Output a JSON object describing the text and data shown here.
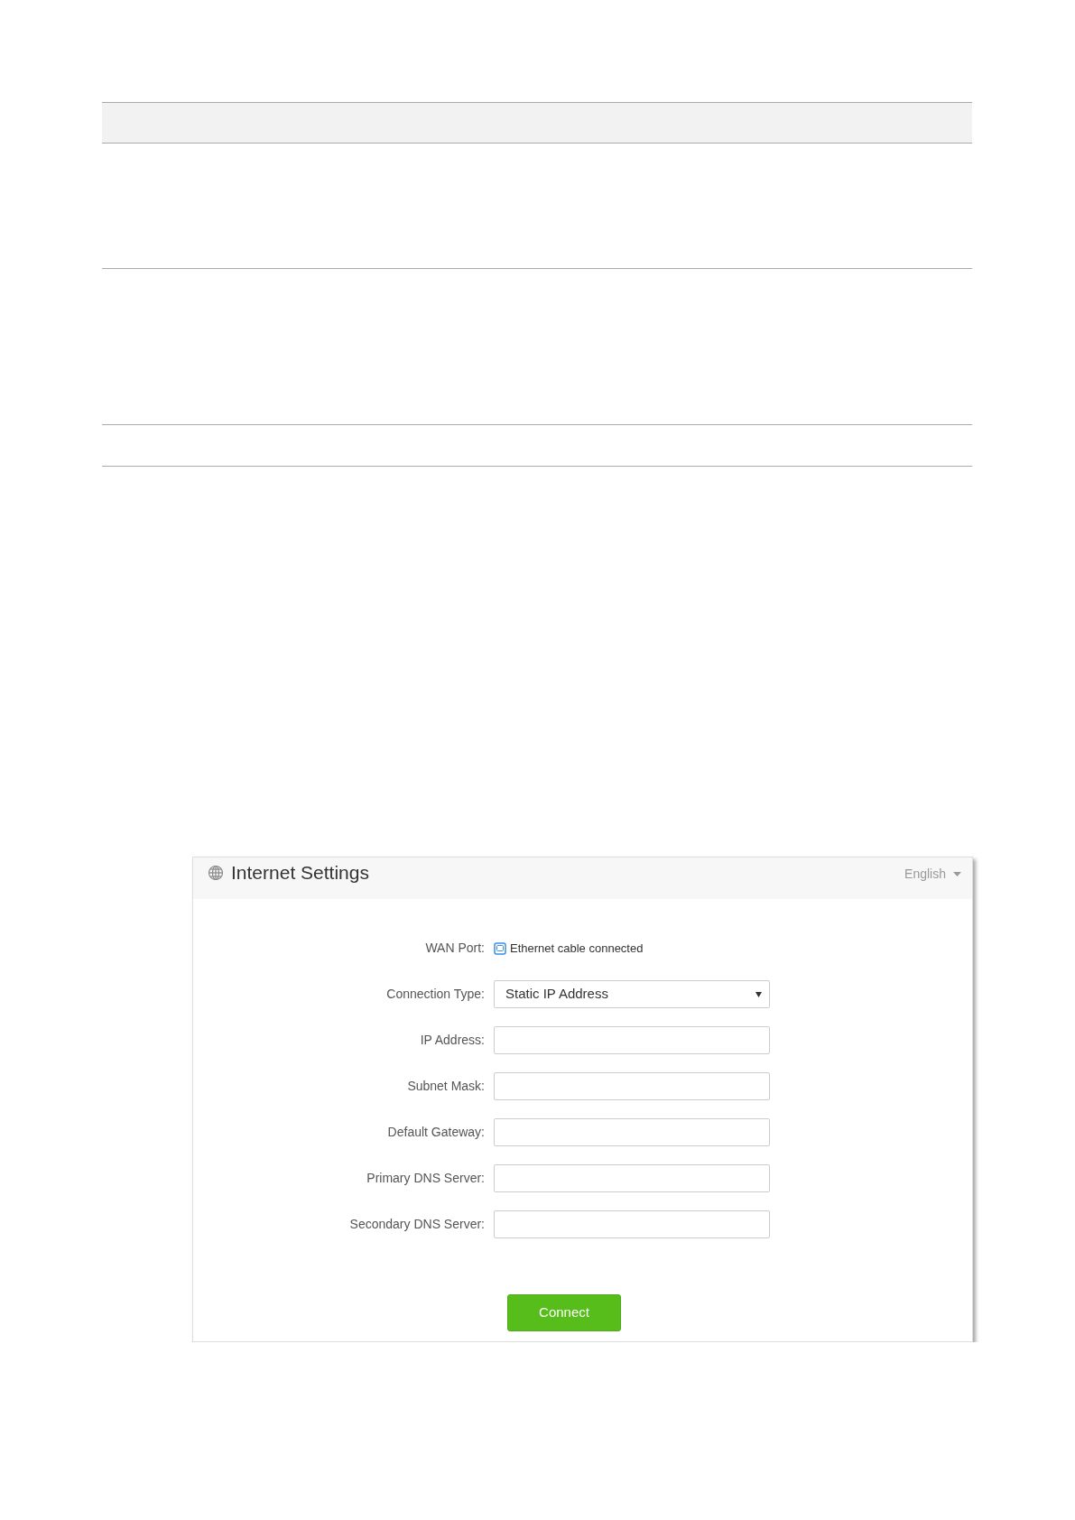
{
  "panel": {
    "title": "Internet Settings",
    "language": "English"
  },
  "fields": [
    {
      "kind": "status",
      "label": "WAN Port:",
      "value": "Ethernet cable connected"
    },
    {
      "kind": "select",
      "label": "Connection Type:",
      "value": "Static IP Address"
    },
    {
      "kind": "input",
      "label": "IP Address:"
    },
    {
      "kind": "input",
      "label": "Subnet Mask:"
    },
    {
      "kind": "input",
      "label": "Default Gateway:"
    },
    {
      "kind": "input",
      "label": "Primary DNS Server:"
    },
    {
      "kind": "input",
      "label": "Secondary DNS Server:"
    }
  ],
  "button": "Connect"
}
